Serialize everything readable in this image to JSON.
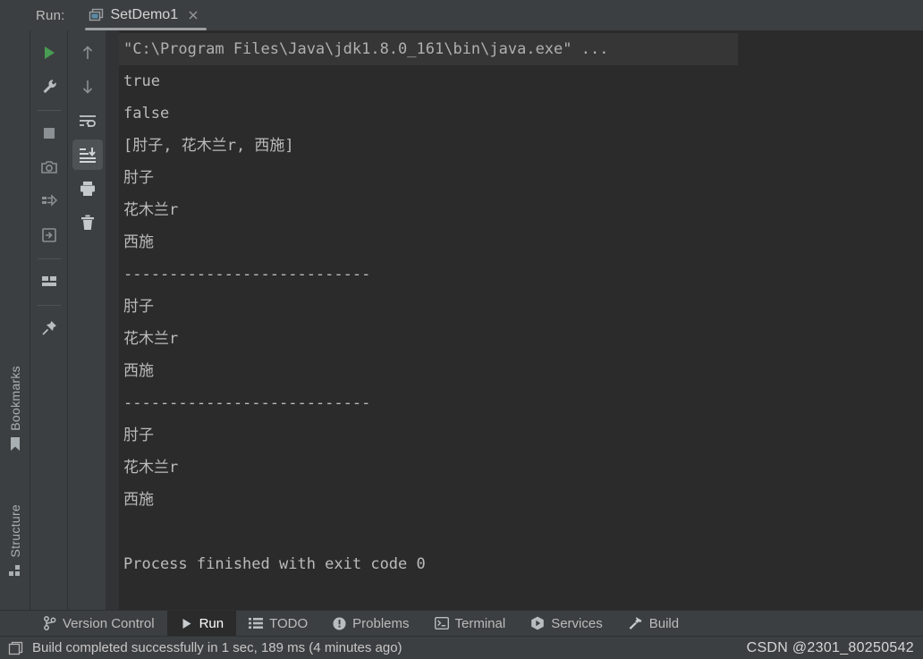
{
  "header": {
    "run_label": "Run:",
    "tab_title": "SetDemo1",
    "tab_icon": "run-configuration-icon",
    "close_icon": "close-icon"
  },
  "left_rail": {
    "tabs": [
      {
        "label": "Bookmarks",
        "icon": "bookmark-icon"
      },
      {
        "label": "Structure",
        "icon": "structure-icon"
      }
    ]
  },
  "toolbar_left": {
    "buttons": [
      {
        "name": "rerun-button",
        "icon": "play-icon",
        "selected": false
      },
      {
        "name": "edit-configuration-button",
        "icon": "wrench-icon",
        "selected": false
      },
      {
        "name": "stop-button",
        "icon": "stop-square-icon",
        "selected": false
      },
      {
        "name": "screenshot-button",
        "icon": "camera-icon",
        "selected": false
      },
      {
        "name": "dump-threads-button",
        "icon": "thread-dump-icon",
        "selected": false
      },
      {
        "name": "restore-layout-button",
        "icon": "restore-window-icon",
        "selected": false
      },
      {
        "name": "layout-settings-button",
        "icon": "layout-icon",
        "selected": false
      },
      {
        "name": "pin-tab-button",
        "icon": "pin-icon",
        "selected": false
      }
    ]
  },
  "toolbar_right": {
    "buttons": [
      {
        "name": "up-the-stack-trace-button",
        "icon": "arrow-up-icon",
        "selected": false
      },
      {
        "name": "down-the-stack-trace-button",
        "icon": "arrow-down-icon",
        "selected": false
      },
      {
        "name": "soft-wrap-button",
        "icon": "soft-wrap-icon",
        "selected": false
      },
      {
        "name": "scroll-to-end-button",
        "icon": "scroll-to-end-icon",
        "selected": true
      },
      {
        "name": "print-button",
        "icon": "printer-icon",
        "selected": false
      },
      {
        "name": "clear-all-button",
        "icon": "trash-icon",
        "selected": false
      }
    ]
  },
  "console": {
    "lines": [
      {
        "text": "\"C:\\Program Files\\Java\\jdk1.8.0_161\\bin\\java.exe\" ...",
        "style": "sys"
      },
      {
        "text": "true",
        "style": "out"
      },
      {
        "text": "false",
        "style": "out"
      },
      {
        "text": "[肘子, 花木兰r, 西施]",
        "style": "out"
      },
      {
        "text": "肘子",
        "style": "out"
      },
      {
        "text": "花木兰r",
        "style": "out"
      },
      {
        "text": "西施",
        "style": "out"
      },
      {
        "text": "---------------------------",
        "style": "out"
      },
      {
        "text": "肘子",
        "style": "out"
      },
      {
        "text": "花木兰r",
        "style": "out"
      },
      {
        "text": "西施",
        "style": "out"
      },
      {
        "text": "---------------------------",
        "style": "out"
      },
      {
        "text": "肘子",
        "style": "out"
      },
      {
        "text": "花木兰r",
        "style": "out"
      },
      {
        "text": "西施",
        "style": "out"
      },
      {
        "text": "",
        "style": "blank"
      },
      {
        "text": "Process finished with exit code 0",
        "style": "out"
      }
    ]
  },
  "bottom_bar": {
    "tabs": [
      {
        "label": "Version Control",
        "icon": "branch-icon",
        "active": false
      },
      {
        "label": "Run",
        "icon": "play-icon",
        "active": true
      },
      {
        "label": "TODO",
        "icon": "list-icon",
        "active": false
      },
      {
        "label": "Problems",
        "icon": "warning-circle-icon",
        "active": false
      },
      {
        "label": "Terminal",
        "icon": "terminal-icon",
        "active": false
      },
      {
        "label": "Services",
        "icon": "services-icon",
        "active": false
      },
      {
        "label": "Build",
        "icon": "hammer-icon",
        "active": false
      }
    ]
  },
  "status_bar": {
    "icon": "window-icon",
    "message": "Build completed successfully in 1 sec, 189 ms (4 minutes ago)",
    "watermark": "CSDN @2301_80250542"
  },
  "colors": {
    "panel_bg": "#3c3f41",
    "console_bg": "#2b2b2b",
    "gutter_bg": "#313335",
    "text": "#bbbbbb",
    "accent_green": "#499c54",
    "selected_bg": "#4e5254"
  }
}
